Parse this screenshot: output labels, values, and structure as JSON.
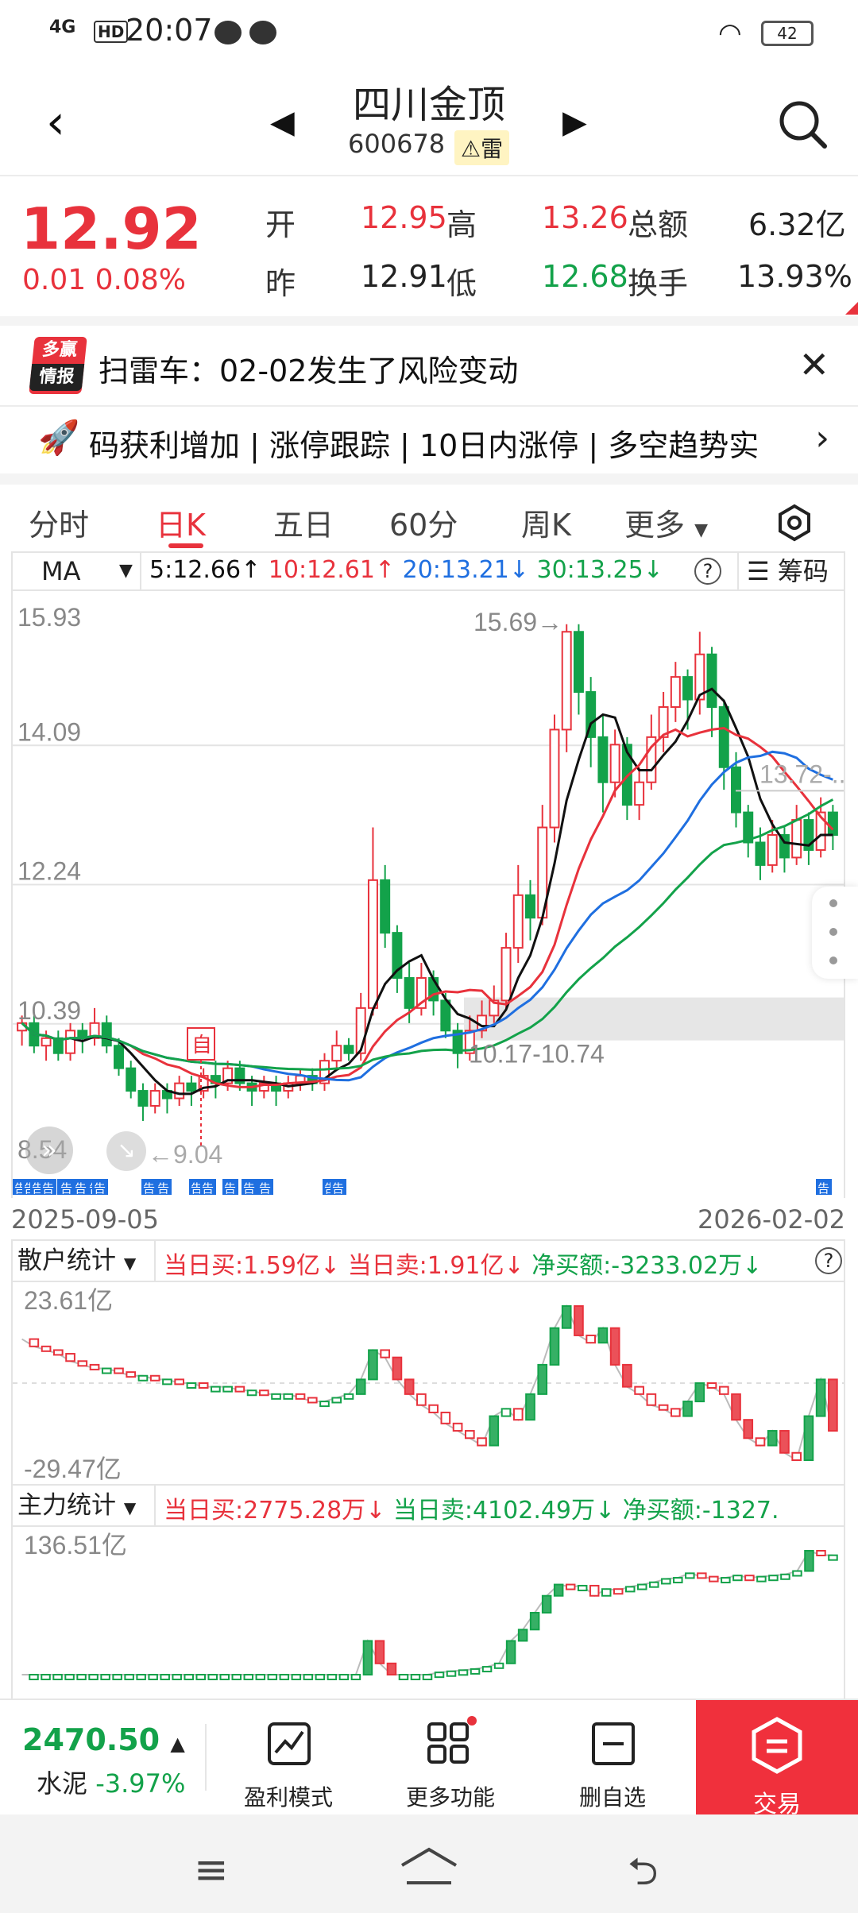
{
  "status_bar": {
    "network": "4G",
    "hd": "HD",
    "time": "20:07",
    "battery": "42"
  },
  "header": {
    "title": "四川金顶",
    "code": "600678",
    "tag": "⚠雷"
  },
  "quote": {
    "price": "12.92",
    "change": "0.01 0.08%",
    "labels": {
      "open": "开",
      "high": "高",
      "amount": "总额",
      "prev": "昨",
      "low": "低",
      "turnover": "换手"
    },
    "open": "12.95",
    "high": "13.26",
    "amount": "6.32亿",
    "prev": "12.91",
    "low": "12.68",
    "turnover": "13.93%"
  },
  "news": {
    "badge_top": "多赢",
    "badge_bottom": "情报",
    "text": "扫雷车：02-02发生了风险变动"
  },
  "ticker": {
    "text": "码获利增加 | 涨停跟踪 | 10日内涨停 | 多空趋势实"
  },
  "tabs": [
    "分时",
    "日K",
    "五日",
    "60分",
    "周K",
    "更多"
  ],
  "ma": {
    "selector": "MA",
    "ma5": "5:12.66↑",
    "ma10": "10:12.61↑",
    "ma20": "20:13.21↓",
    "ma30": "30:13.25↓",
    "help": "?",
    "chouma": "筹码"
  },
  "chart": {
    "y_labels": [
      "15.93",
      "14.09",
      "12.24",
      "10.39",
      "8.54"
    ],
    "high_mark": "15.69→",
    "right_mark": "13.72-...",
    "zone_label": "10.17-10.74",
    "low_mark": "←9.04",
    "self_tag": "自",
    "gao": "告",
    "date_start": "2025-09-05",
    "date_end": "2026-02-02",
    "colors": {
      "up": "#e8323c",
      "down": "#13a24a",
      "ma5": "#111111",
      "ma10": "#e8323c",
      "ma20": "#1f6fe0",
      "ma30": "#13a24a"
    },
    "candles": [
      [
        10.3,
        10.4,
        10.1,
        10.5
      ],
      [
        10.4,
        10.1,
        10.0,
        10.5
      ],
      [
        10.1,
        10.2,
        9.9,
        10.3
      ],
      [
        10.2,
        10.0,
        9.9,
        10.3
      ],
      [
        10.0,
        10.3,
        9.9,
        10.4
      ],
      [
        10.3,
        10.2,
        10.0,
        10.4
      ],
      [
        10.2,
        10.4,
        10.1,
        10.6
      ],
      [
        10.4,
        10.1,
        10.0,
        10.5
      ],
      [
        10.1,
        9.8,
        9.7,
        10.2
      ],
      [
        9.8,
        9.5,
        9.4,
        9.9
      ],
      [
        9.5,
        9.3,
        9.1,
        9.6
      ],
      [
        9.3,
        9.5,
        9.2,
        9.6
      ],
      [
        9.5,
        9.4,
        9.2,
        9.6
      ],
      [
        9.4,
        9.6,
        9.3,
        9.7
      ],
      [
        9.6,
        9.5,
        9.3,
        9.7
      ],
      [
        9.5,
        9.7,
        9.4,
        9.8
      ],
      [
        9.7,
        9.6,
        9.4,
        9.9
      ],
      [
        9.6,
        9.8,
        9.5,
        9.9
      ],
      [
        9.8,
        9.6,
        9.5,
        9.9
      ],
      [
        9.6,
        9.5,
        9.3,
        9.7
      ],
      [
        9.5,
        9.6,
        9.4,
        9.7
      ],
      [
        9.6,
        9.5,
        9.3,
        9.7
      ],
      [
        9.5,
        9.6,
        9.4,
        9.7
      ],
      [
        9.6,
        9.7,
        9.5,
        9.8
      ],
      [
        9.7,
        9.6,
        9.5,
        9.8
      ],
      [
        9.6,
        9.9,
        9.5,
        10.0
      ],
      [
        9.9,
        10.1,
        9.8,
        10.3
      ],
      [
        10.1,
        10.0,
        9.9,
        10.2
      ],
      [
        10.0,
        10.6,
        9.9,
        10.8
      ],
      [
        10.6,
        12.3,
        10.5,
        13.0
      ],
      [
        12.3,
        11.6,
        11.4,
        12.5
      ],
      [
        11.6,
        11.0,
        10.8,
        11.7
      ],
      [
        11.0,
        10.6,
        10.4,
        11.2
      ],
      [
        10.6,
        11.0,
        10.5,
        11.2
      ],
      [
        11.0,
        10.7,
        10.5,
        11.1
      ],
      [
        10.7,
        10.3,
        10.2,
        10.8
      ],
      [
        10.3,
        10.0,
        9.8,
        10.4
      ],
      [
        10.0,
        10.3,
        9.9,
        10.5
      ],
      [
        10.3,
        10.5,
        10.2,
        10.7
      ],
      [
        10.5,
        10.7,
        10.4,
        10.9
      ],
      [
        10.7,
        11.4,
        10.6,
        11.6
      ],
      [
        11.4,
        12.1,
        11.2,
        12.5
      ],
      [
        12.1,
        11.8,
        11.5,
        12.3
      ],
      [
        11.8,
        13.0,
        11.7,
        13.3
      ],
      [
        13.0,
        14.3,
        12.8,
        14.5
      ],
      [
        14.3,
        15.6,
        14.0,
        15.7
      ],
      [
        15.6,
        14.8,
        14.5,
        15.7
      ],
      [
        14.8,
        14.2,
        13.8,
        15.0
      ],
      [
        14.2,
        13.6,
        13.2,
        14.5
      ],
      [
        13.6,
        14.1,
        13.4,
        14.3
      ],
      [
        14.1,
        13.3,
        13.1,
        14.2
      ],
      [
        13.3,
        13.6,
        13.1,
        13.8
      ],
      [
        13.6,
        14.2,
        13.5,
        14.5
      ],
      [
        14.2,
        14.6,
        14.0,
        14.8
      ],
      [
        14.6,
        15.0,
        14.4,
        15.2
      ],
      [
        15.0,
        14.7,
        14.3,
        15.1
      ],
      [
        14.7,
        15.3,
        14.5,
        15.6
      ],
      [
        15.3,
        14.6,
        14.2,
        15.4
      ],
      [
        14.6,
        13.8,
        13.5,
        14.7
      ],
      [
        13.8,
        13.2,
        13.0,
        14.0
      ],
      [
        13.2,
        12.8,
        12.6,
        13.3
      ],
      [
        12.8,
        12.5,
        12.3,
        13.0
      ],
      [
        12.5,
        12.9,
        12.4,
        13.1
      ],
      [
        12.9,
        12.6,
        12.4,
        13.0
      ],
      [
        12.6,
        13.1,
        12.5,
        13.3
      ],
      [
        13.1,
        12.7,
        12.5,
        13.2
      ],
      [
        12.7,
        13.2,
        12.6,
        13.4
      ],
      [
        13.2,
        12.9,
        12.7,
        13.3
      ]
    ]
  },
  "retail": {
    "selector": "散户统计",
    "buy": "当日买:1.59亿↓",
    "sell": "当日卖:1.91亿↓",
    "net": "净买额:-3233.02万↓",
    "top": "23.61亿",
    "bottom": "-29.47亿",
    "values": [
      0.5,
      0.3,
      0.2,
      0.1,
      -0.1,
      -0.2,
      -0.3,
      -0.3,
      -0.4,
      -0.5,
      -0.5,
      -0.6,
      -0.6,
      -0.7,
      -0.7,
      -0.8,
      -0.8,
      -0.8,
      -0.9,
      -0.9,
      -1.0,
      -1.0,
      -1.0,
      -1.1,
      -1.2,
      -1.2,
      -1.1,
      -1.0,
      -0.6,
      0.2,
      0.0,
      -0.6,
      -1.0,
      -1.3,
      -1.5,
      -1.8,
      -2.0,
      -2.2,
      -2.4,
      -1.6,
      -1.4,
      -1.7,
      -1.0,
      -0.2,
      0.8,
      1.4,
      0.6,
      0.4,
      0.8,
      -0.2,
      -0.8,
      -1.0,
      -1.3,
      -1.4,
      -1.6,
      -1.2,
      -0.7,
      -0.8,
      -1.0,
      -1.7,
      -2.2,
      -2.4,
      -2.0,
      -2.6,
      -2.8,
      -1.6,
      -0.6,
      -2.0
    ]
  },
  "main": {
    "selector": "主力统计",
    "buy": "当日买:2775.28万↓",
    "sell": "当日卖:4102.49万↓",
    "net": "净买额:-1327.",
    "top": "136.51亿",
    "values": [
      -9,
      -9,
      -9,
      -9,
      -9,
      -9,
      -9,
      -9,
      -9,
      -9,
      -9,
      -9,
      -9,
      -9,
      -9,
      -9,
      -9,
      -9,
      -9,
      -9,
      -9,
      -9,
      -9,
      -9,
      -9,
      -9,
      -9,
      -9,
      -9,
      -6,
      -8,
      -9,
      -9,
      -9,
      -9,
      -8.8,
      -8.7,
      -8.6,
      -8.5,
      -8.3,
      -8.0,
      -6.0,
      -5.0,
      -3.5,
      -2.0,
      -1.0,
      -1.2,
      -1.1,
      -2.0,
      -1.4,
      -1.5,
      -1.2,
      -1.0,
      -0.8,
      -0.5,
      -0.4,
      0.0,
      -0.3,
      -0.5,
      -0.4,
      -0.2,
      -0.4,
      -0.3,
      -0.2,
      -0.1,
      0.2,
      2.0,
      1.6,
      1.6
    ]
  },
  "bottom_bar": {
    "index_value": "2470.50",
    "index_name": "水泥",
    "index_change": "-3.97%",
    "btn_profit": "盈利模式",
    "btn_more": "更多功能",
    "btn_remove": "删自选",
    "btn_trade": "交易"
  }
}
